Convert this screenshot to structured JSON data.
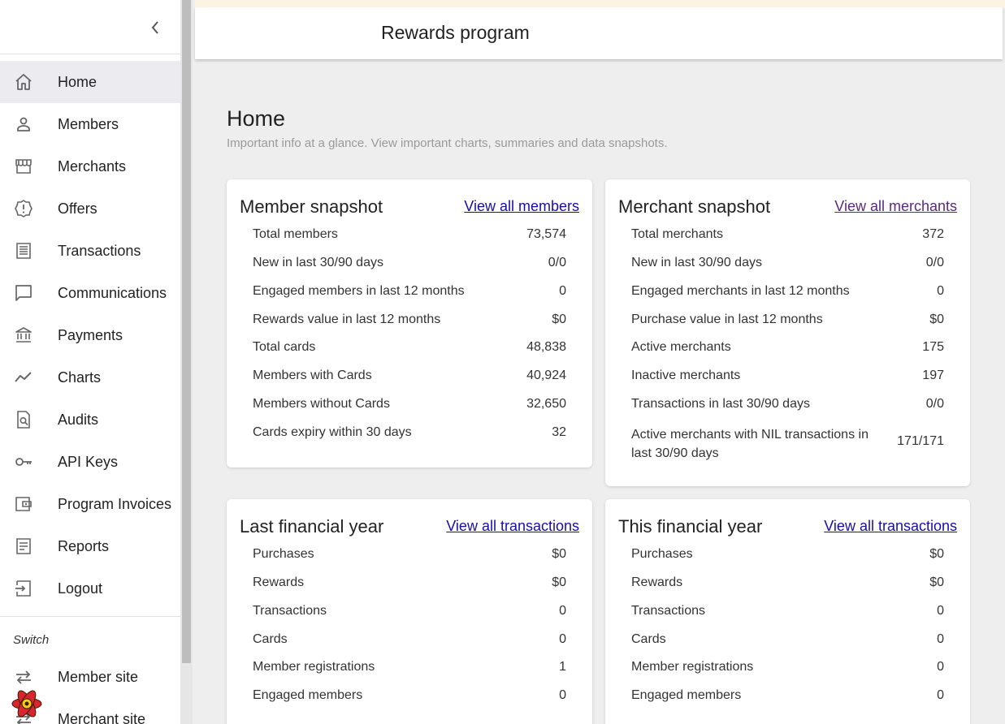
{
  "header": {
    "title": "Rewards program"
  },
  "page": {
    "title": "Home",
    "subtitle": "Important info at a glance. View important charts, summaries and data snapshots."
  },
  "sidebar": {
    "items": [
      {
        "label": "Home",
        "icon": "home-icon"
      },
      {
        "label": "Members",
        "icon": "person-icon"
      },
      {
        "label": "Merchants",
        "icon": "store-icon"
      },
      {
        "label": "Offers",
        "icon": "badge-alert-icon"
      },
      {
        "label": "Transactions",
        "icon": "receipt-icon"
      },
      {
        "label": "Communications",
        "icon": "chat-icon"
      },
      {
        "label": "Payments",
        "icon": "bank-icon"
      },
      {
        "label": "Charts",
        "icon": "line-chart-icon"
      },
      {
        "label": "Audits",
        "icon": "audit-search-icon"
      },
      {
        "label": "API Keys",
        "icon": "key-icon"
      },
      {
        "label": "Program Invoices",
        "icon": "wallet-icon"
      },
      {
        "label": "Reports",
        "icon": "report-icon"
      },
      {
        "label": "Logout",
        "icon": "logout-icon"
      }
    ],
    "switch_label": "Switch",
    "switch_items": [
      {
        "label": "Member site",
        "icon": "swap-icon"
      },
      {
        "label": "Merchant site",
        "icon": "swap-icon"
      }
    ]
  },
  "cards": {
    "member_snapshot": {
      "title": "Member snapshot",
      "link": "View all members",
      "rows": [
        {
          "label": "Total members",
          "value": "73,574"
        },
        {
          "label": "New in last 30/90 days",
          "value": "0/0"
        },
        {
          "label": "Engaged members in last 12 months",
          "value": "0"
        },
        {
          "label": "Rewards value in last 12 months",
          "value": "$0"
        },
        {
          "label": "Total cards",
          "value": "48,838"
        },
        {
          "label": "Members with Cards",
          "value": "40,924"
        },
        {
          "label": "Members without Cards",
          "value": "32,650"
        },
        {
          "label": "Cards expiry within 30 days",
          "value": "32"
        }
      ]
    },
    "merchant_snapshot": {
      "title": "Merchant snapshot",
      "link": "View all merchants",
      "rows": [
        {
          "label": "Total merchants",
          "value": "372"
        },
        {
          "label": "New in last 30/90 days",
          "value": "0/0"
        },
        {
          "label": "Engaged merchants in last 12 months",
          "value": "0"
        },
        {
          "label": "Purchase value in last 12 months",
          "value": "$0"
        },
        {
          "label": "Active merchants",
          "value": "175"
        },
        {
          "label": "Inactive merchants",
          "value": "197"
        },
        {
          "label": "Transactions in last 30/90 days",
          "value": "0/0"
        },
        {
          "label": "Active merchants with NIL transactions in last 30/90 days",
          "value": "171/171"
        }
      ]
    },
    "last_fy": {
      "title": "Last financial year",
      "link": "View all transactions",
      "rows": [
        {
          "label": "Purchases",
          "value": "$0"
        },
        {
          "label": "Rewards",
          "value": "$0"
        },
        {
          "label": "Transactions",
          "value": "0"
        },
        {
          "label": "Cards",
          "value": "0"
        },
        {
          "label": "Member registrations",
          "value": "1"
        },
        {
          "label": "Engaged members",
          "value": "0"
        }
      ]
    },
    "this_fy": {
      "title": "This financial year",
      "link": "View all transactions",
      "rows": [
        {
          "label": "Purchases",
          "value": "$0"
        },
        {
          "label": "Rewards",
          "value": "$0"
        },
        {
          "label": "Transactions",
          "value": "0"
        },
        {
          "label": "Cards",
          "value": "0"
        },
        {
          "label": "Member registrations",
          "value": "0"
        },
        {
          "label": "Engaged members",
          "value": "0"
        }
      ]
    }
  },
  "colors": {
    "link": "#1a0dab",
    "link_visited": "#5a2a82",
    "active_nav_bg": "#ececf0",
    "top_stripe": "#fdf3e3"
  }
}
